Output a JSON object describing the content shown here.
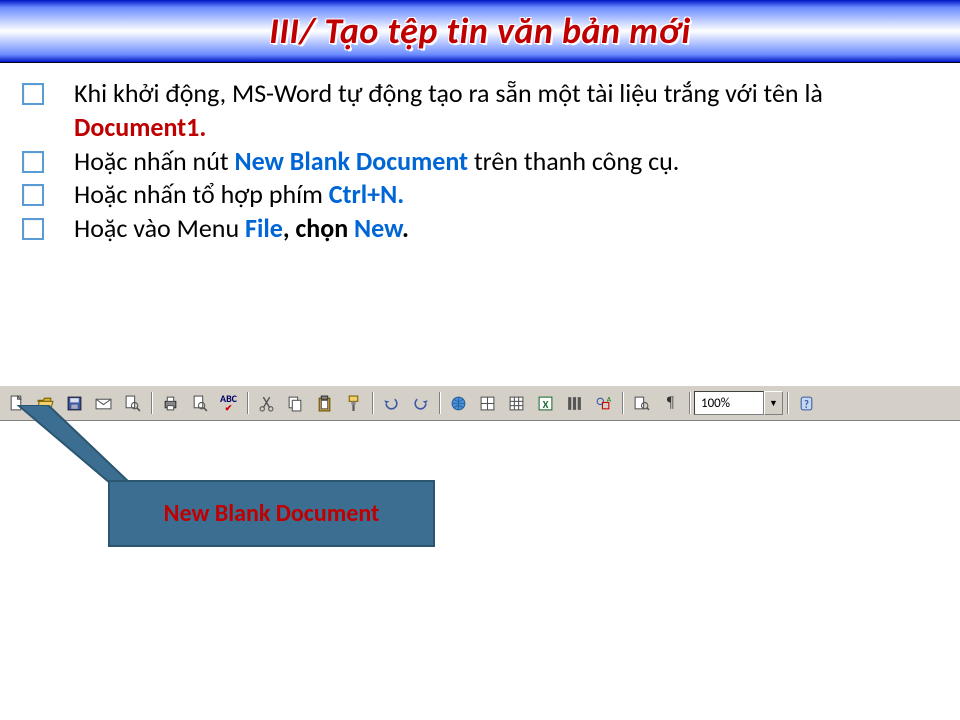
{
  "title": "III/ Tạo tệp tin văn bản mới",
  "bullets": {
    "b1a": "Khi khởi động, MS-Word tự động tạo ra sẵn một tài liệu trắng với tên là ",
    "b1b": "Document1.",
    "b2a": "Hoặc nhấn nút ",
    "b2b": "New Blank Document",
    "b2c": " trên thanh công cụ.",
    "b3a": "Hoặc nhấn tổ hợp phím ",
    "b3b": "Ctrl+N.",
    "b4a": "Hoặc vào Menu ",
    "b4b": "File",
    "b4c": ", chọn ",
    "b4d": "New",
    "b4e": "."
  },
  "toolbar": {
    "zoom": "100%",
    "icons": [
      "new",
      "open",
      "save",
      "mail",
      "search-doc",
      "print",
      "preview",
      "spellcheck",
      "cut",
      "copy",
      "paste",
      "format-painter",
      "undo",
      "redo",
      "link",
      "tables-borders",
      "insert-table",
      "excel",
      "columns",
      "drawing",
      "doc-map",
      "paragraph-marks",
      "help"
    ]
  },
  "callout": "New Blank Document"
}
